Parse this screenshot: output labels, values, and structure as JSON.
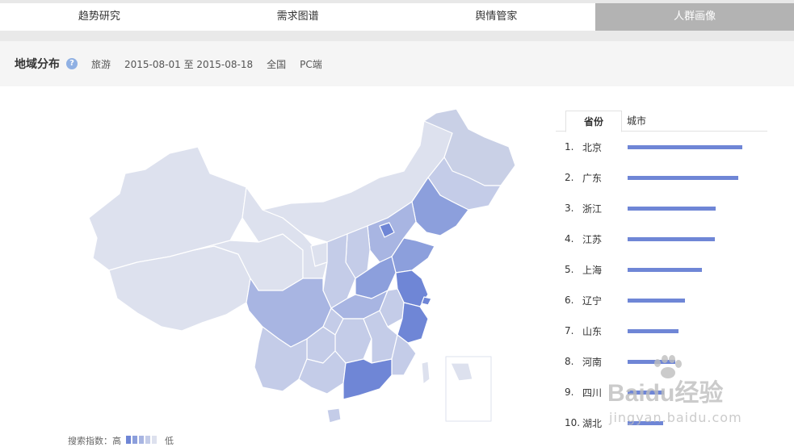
{
  "tabs": [
    {
      "label": "趋势研究",
      "active": false
    },
    {
      "label": "需求图谱",
      "active": false
    },
    {
      "label": "舆情管家",
      "active": false
    },
    {
      "label": "人群画像",
      "active": true
    }
  ],
  "filter": {
    "title": "地域分布",
    "help_icon": "help-circle-icon",
    "keyword": "旅游",
    "date_range": "2015-08-01 至 2015-08-18",
    "region": "全国",
    "device": "PC端"
  },
  "legend": {
    "label": "搜索指数：高",
    "low": "低",
    "colors": [
      "#6f86d6",
      "#8c9fdc",
      "#a8b5e2",
      "#c4cce8",
      "#dde1ee"
    ]
  },
  "rank_tabs": [
    {
      "label": "省份",
      "active": true
    },
    {
      "label": "城市",
      "active": false
    }
  ],
  "ranking": [
    {
      "rank": "1.",
      "name": "北京",
      "value": 142
    },
    {
      "rank": "2.",
      "name": "广东",
      "value": 137
    },
    {
      "rank": "3.",
      "name": "浙江",
      "value": 109
    },
    {
      "rank": "4.",
      "name": "江苏",
      "value": 108
    },
    {
      "rank": "5.",
      "name": "上海",
      "value": 92
    },
    {
      "rank": "6.",
      "name": "辽宁",
      "value": 71
    },
    {
      "rank": "7.",
      "name": "山东",
      "value": 63
    },
    {
      "rank": "8.",
      "name": "河南",
      "value": 59
    },
    {
      "rank": "9.",
      "name": "四川",
      "value": 45
    },
    {
      "rank": "10.",
      "name": "湖北",
      "value": 44
    }
  ],
  "watermark": {
    "title": "Baidu经验",
    "sub": "jingyan.baidu.com"
  }
}
